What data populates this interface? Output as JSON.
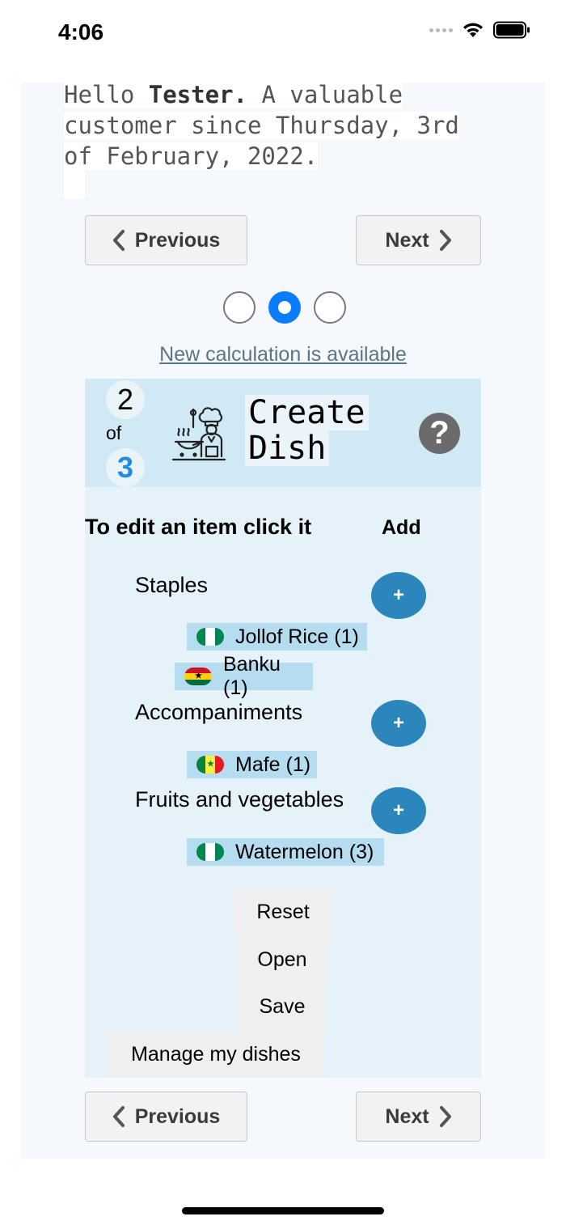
{
  "status_bar": {
    "time": "4:06",
    "icons": [
      "signal-dots",
      "wifi-icon",
      "battery-icon"
    ]
  },
  "greeting": {
    "hello": "Hello",
    "name": "Tester.",
    "rest_line1": "A valuable",
    "line2": "customer since Thursday, 3rd",
    "line3": "of February, 2022."
  },
  "nav": {
    "previous_label": "Previous",
    "next_label": "Next"
  },
  "pager": {
    "count": 3,
    "active_index": 1
  },
  "calc_link": "New calculation is available",
  "card": {
    "step_current": "2",
    "step_of": "of",
    "step_total": "3",
    "title_line1": "Create",
    "title_line2": "Dish",
    "help_glyph": "?",
    "edit_hint": "To edit an item click it",
    "add_label": "Add",
    "add_glyph": "+",
    "categories": [
      {
        "name": "Staples",
        "items": [
          {
            "label": "Jollof Rice (1)",
            "flag": "nigeria"
          },
          {
            "label": "Banku (1)",
            "flag": "ghana"
          }
        ]
      },
      {
        "name": "Accompaniments",
        "items": [
          {
            "label": "Mafe (1)",
            "flag": "senegal"
          }
        ]
      },
      {
        "name": "Fruits and vegetables",
        "items": [
          {
            "label": "Watermelon (3)",
            "flag": "nigeria"
          }
        ]
      }
    ],
    "menu": {
      "reset": "Reset",
      "open": "Open",
      "save": "Save",
      "manage": "Manage my dishes"
    }
  },
  "colors": {
    "accent": "#0a7cff",
    "add_button": "#2a86bb",
    "item_bg": "#b5dcef",
    "header_bg": "#d0e9f5"
  }
}
